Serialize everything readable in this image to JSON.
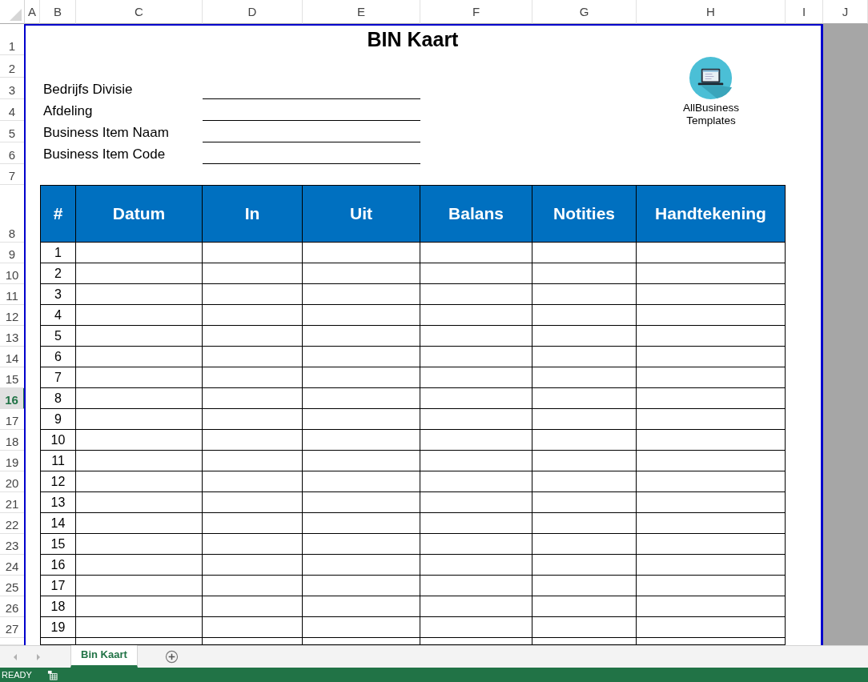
{
  "column_headers": [
    {
      "label": "A"
    },
    {
      "label": "B"
    },
    {
      "label": "C"
    },
    {
      "label": "D"
    },
    {
      "label": "E"
    },
    {
      "label": "F"
    },
    {
      "label": "G"
    },
    {
      "label": "H"
    },
    {
      "label": "I"
    },
    {
      "label": "J"
    }
  ],
  "row_headers": [
    {
      "label": "1",
      "selected": false
    },
    {
      "label": "2",
      "selected": false
    },
    {
      "label": "3",
      "selected": false
    },
    {
      "label": "4",
      "selected": false
    },
    {
      "label": "5",
      "selected": false
    },
    {
      "label": "6",
      "selected": false
    },
    {
      "label": "7",
      "selected": false
    },
    {
      "label": "8",
      "selected": false
    },
    {
      "label": "9",
      "selected": false
    },
    {
      "label": "10",
      "selected": false
    },
    {
      "label": "11",
      "selected": false
    },
    {
      "label": "12",
      "selected": false
    },
    {
      "label": "13",
      "selected": false
    },
    {
      "label": "14",
      "selected": false
    },
    {
      "label": "15",
      "selected": false
    },
    {
      "label": "16",
      "selected": true
    },
    {
      "label": "17",
      "selected": false
    },
    {
      "label": "18",
      "selected": false
    },
    {
      "label": "19",
      "selected": false
    },
    {
      "label": "20",
      "selected": false
    },
    {
      "label": "21",
      "selected": false
    },
    {
      "label": "22",
      "selected": false
    },
    {
      "label": "23",
      "selected": false
    },
    {
      "label": "24",
      "selected": false
    },
    {
      "label": "25",
      "selected": false
    },
    {
      "label": "26",
      "selected": false
    },
    {
      "label": "27",
      "selected": false
    }
  ],
  "title": "BIN Kaart",
  "form_fields": [
    {
      "label": "Bedrijfs Divisie"
    },
    {
      "label": "Afdeling"
    },
    {
      "label": "Business Item Naam"
    },
    {
      "label": "Business Item Code"
    }
  ],
  "logo": {
    "text": "AllBusiness Templates"
  },
  "table": {
    "columns": [
      "#",
      "Datum",
      "In",
      "Uit",
      "Balans",
      "Notities",
      "Handtekening"
    ],
    "rows": [
      {
        "number": "1"
      },
      {
        "number": "2"
      },
      {
        "number": "3"
      },
      {
        "number": "4"
      },
      {
        "number": "5"
      },
      {
        "number": "6"
      },
      {
        "number": "7"
      },
      {
        "number": "8"
      },
      {
        "number": "9"
      },
      {
        "number": "10"
      },
      {
        "number": "11"
      },
      {
        "number": "12"
      },
      {
        "number": "13"
      },
      {
        "number": "14"
      },
      {
        "number": "15"
      },
      {
        "number": "16"
      },
      {
        "number": "17"
      },
      {
        "number": "18"
      },
      {
        "number": "19"
      }
    ]
  },
  "sheet_tabs": [
    {
      "label": "Bin Kaart",
      "selected": true
    }
  ],
  "status_bar": {
    "text": "READY"
  }
}
